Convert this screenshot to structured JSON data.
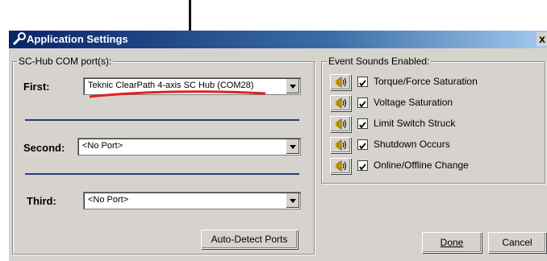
{
  "window": {
    "title": "Application Settings",
    "close_glyph": "x"
  },
  "com_group": {
    "legend": "SC-Hub COM port(s):",
    "first": {
      "label": "First:",
      "value": "Teknic ClearPath 4-axis SC Hub (COM28)"
    },
    "second": {
      "label": "Second:",
      "value": "<No Port>"
    },
    "third": {
      "label": "Third:",
      "value": "<No Port>"
    },
    "auto_detect": "Auto-Detect Ports"
  },
  "sounds": {
    "legend": "Event Sounds Enabled:",
    "items": [
      {
        "label": "Torque/Force Saturation",
        "checked": true
      },
      {
        "label": "Voltage Saturation",
        "checked": true
      },
      {
        "label": "Limit Switch Struck",
        "checked": true
      },
      {
        "label": "Shutdown Occurs",
        "checked": true
      },
      {
        "label": "Online/Offline Change",
        "checked": true
      }
    ]
  },
  "buttons": {
    "done": "Done",
    "cancel": "Cancel"
  },
  "colors": {
    "annotation_underline": "#e02020",
    "title_gradient_start": "#0a246a"
  }
}
